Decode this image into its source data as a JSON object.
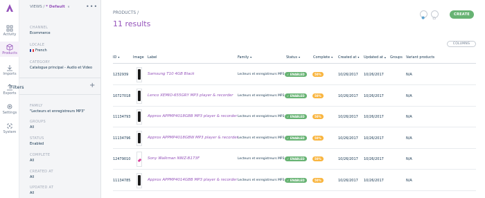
{
  "nav": {
    "items": [
      {
        "label": "Activity",
        "icon": "grid-icon"
      },
      {
        "label": "Products",
        "icon": "product-icon",
        "active": true
      },
      {
        "label": "Imports",
        "icon": "import-icon"
      },
      {
        "label": "Exports",
        "icon": "export-icon"
      },
      {
        "label": "Settings",
        "icon": "gear-icon"
      },
      {
        "label": "System",
        "icon": "system-icon"
      }
    ]
  },
  "panel": {
    "views_prefix": "VIEWS / ",
    "views_value": "* Default",
    "views_caret": "∨",
    "more": "•••",
    "channel_label": "CHANNEL",
    "channel_value": "Ecommerce",
    "locale_label": "LOCALE",
    "locale_value": "French",
    "category_label": "CATEGORY",
    "category_value": "Catalogue principal - Audio et Video",
    "filters_title": "Filters",
    "filters_add": "+",
    "filters": [
      {
        "label": "FAMILY",
        "value": "\"Lecteurs et enregistreurs MP3\""
      },
      {
        "label": "GROUPS",
        "value": "All"
      },
      {
        "label": "STATUS",
        "value": "Enabled"
      },
      {
        "label": "COMPLETE",
        "value": "All"
      },
      {
        "label": "CREATED AT",
        "value": "All"
      },
      {
        "label": "UPDATED AT",
        "value": "All"
      }
    ]
  },
  "main": {
    "breadcrumb": "PRODUCTS /",
    "results": "11 results",
    "create_label": "CREATE",
    "columns_label": "COLUMNS",
    "headers": {
      "id": "ID",
      "image": "Image",
      "label": "Label",
      "family": "Family",
      "status": "Status",
      "complete": "Complete",
      "created": "Created at",
      "updated": "Updated at",
      "groups": "Groups",
      "variant": "Variant products"
    },
    "rows": [
      {
        "id": "1232939",
        "label": "Samsung T10 4GB Black",
        "family": "Lecteurs et enregistreurs MP3",
        "status": "ENABLED",
        "complete": "50%",
        "created": "10/26/2017",
        "updated": "10/26/2017",
        "variant": "N/A",
        "thumb": "black"
      },
      {
        "id": "10727018",
        "label": "Lenco XEMIO-655GRY MP3 player & recorder",
        "family": "Lecteurs et enregistreurs MP3",
        "status": "ENABLED",
        "complete": "50%",
        "created": "10/26/2017",
        "updated": "10/26/2017",
        "variant": "N/A",
        "thumb": "black"
      },
      {
        "id": "11134793",
        "label": "Approx APPMP4018GBB MP3 player & recorder",
        "family": "Lecteurs et enregistreurs MP3",
        "status": "ENABLED",
        "complete": "50%",
        "created": "10/26/2017",
        "updated": "10/26/2017",
        "variant": "N/A",
        "thumb": "black"
      },
      {
        "id": "11134796",
        "label": "Approx APPMP4018GBW MP3 player & recorder",
        "family": "Lecteurs et enregistreurs MP3",
        "status": "ENABLED",
        "complete": "50%",
        "created": "10/26/2017",
        "updated": "10/26/2017",
        "variant": "N/A",
        "thumb": "black"
      },
      {
        "id": "12479010",
        "label": "Sony Walkman NWZ-B173F",
        "family": "Lecteurs et enregistreurs MP3",
        "status": "ENABLED",
        "complete": "50%",
        "created": "10/26/2017",
        "updated": "10/26/2017",
        "variant": "N/A",
        "thumb": "pink"
      },
      {
        "id": "11134785",
        "label": "Approx APPMP4014GBB MP3 player & recorder",
        "family": "Lecteurs et enregistreurs MP3",
        "status": "ENABLED",
        "complete": "50%",
        "created": "10/26/2017",
        "updated": "10/26/2017",
        "variant": "N/A",
        "thumb": "black"
      }
    ]
  },
  "colors": {
    "accent": "#9452ba",
    "enabled": "#67b373",
    "complete": "#f9b53f"
  }
}
